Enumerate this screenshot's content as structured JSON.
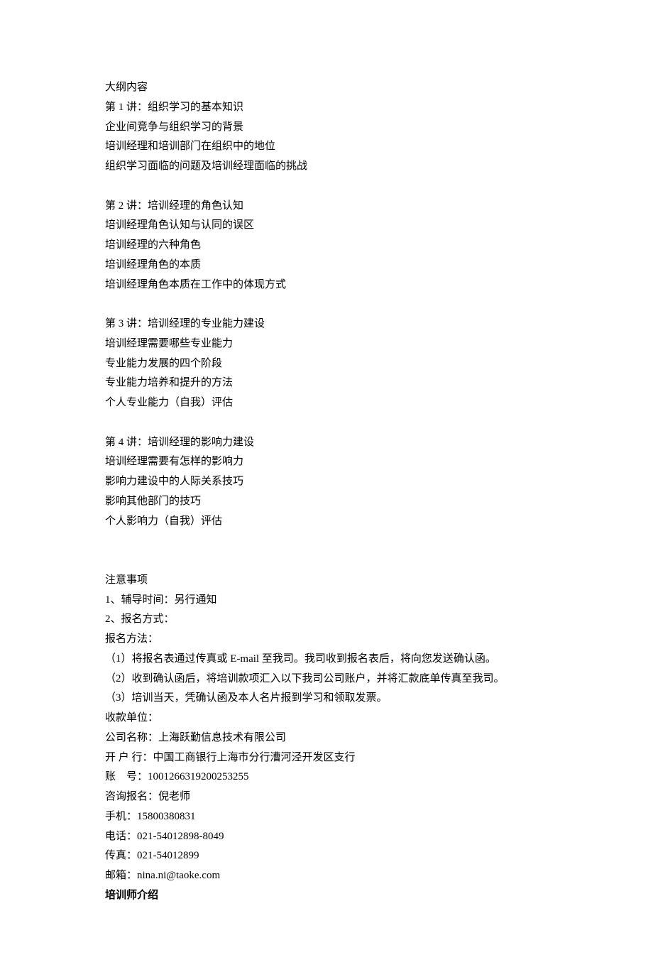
{
  "outline": {
    "heading": "大纲内容",
    "section1": {
      "title": "第 1 讲：组织学习的基本知识",
      "l1": "企业间竞争与组织学习的背景",
      "l2": "培训经理和培训部门在组织中的地位",
      "l3": "组织学习面临的问题及培训经理面临的挑战"
    },
    "section2": {
      "title": "第 2 讲：培训经理的角色认知",
      "l1": "培训经理角色认知与认同的误区",
      "l2": "培训经理的六种角色",
      "l3": "培训经理角色的本质",
      "l4": "培训经理角色本质在工作中的体现方式"
    },
    "section3": {
      "title": "第 3 讲：培训经理的专业能力建设",
      "l1": "培训经理需要哪些专业能力",
      "l2": "专业能力发展的四个阶段",
      "l3": "专业能力培养和提升的方法",
      "l4": "个人专业能力（自我）评估"
    },
    "section4": {
      "title": "第 4 讲：培训经理的影响力建设",
      "l1": "培训经理需要有怎样的影响力",
      "l2": "影响力建设中的人际关系技巧",
      "l3": "影响其他部门的技巧",
      "l4": "个人影响力（自我）评估"
    }
  },
  "notes": {
    "heading": "注意事项",
    "l1": "1、辅导时间：另行通知",
    "l2": "2、报名方式：",
    "l3": "报名方法：",
    "l4": "（1）将报名表通过传真或 E-mail 至我司。我司收到报名表后，将向您发送确认函。",
    "l5": "（2）收到确认函后，将培训款项汇入以下我司公司账户，并将汇款底单传真至我司。",
    "l6": "（3）培训当天，凭确认函及本人名片报到学习和领取发票。",
    "l7": "收款单位：",
    "l8": "公司名称：上海跃勤信息技术有限公司",
    "l9": "开 户 行：中国工商银行上海市分行漕河泾开发区支行",
    "l10": "账　号：1001266319200253255",
    "l11": "咨询报名：倪老师",
    "l12": "手机：15800380831",
    "l13": "电话：021-54012898-8049",
    "l14": "传真：021-54012899",
    "l15": "邮箱：nina.ni@taoke.com"
  },
  "trainer": {
    "heading": "培训师介绍"
  }
}
